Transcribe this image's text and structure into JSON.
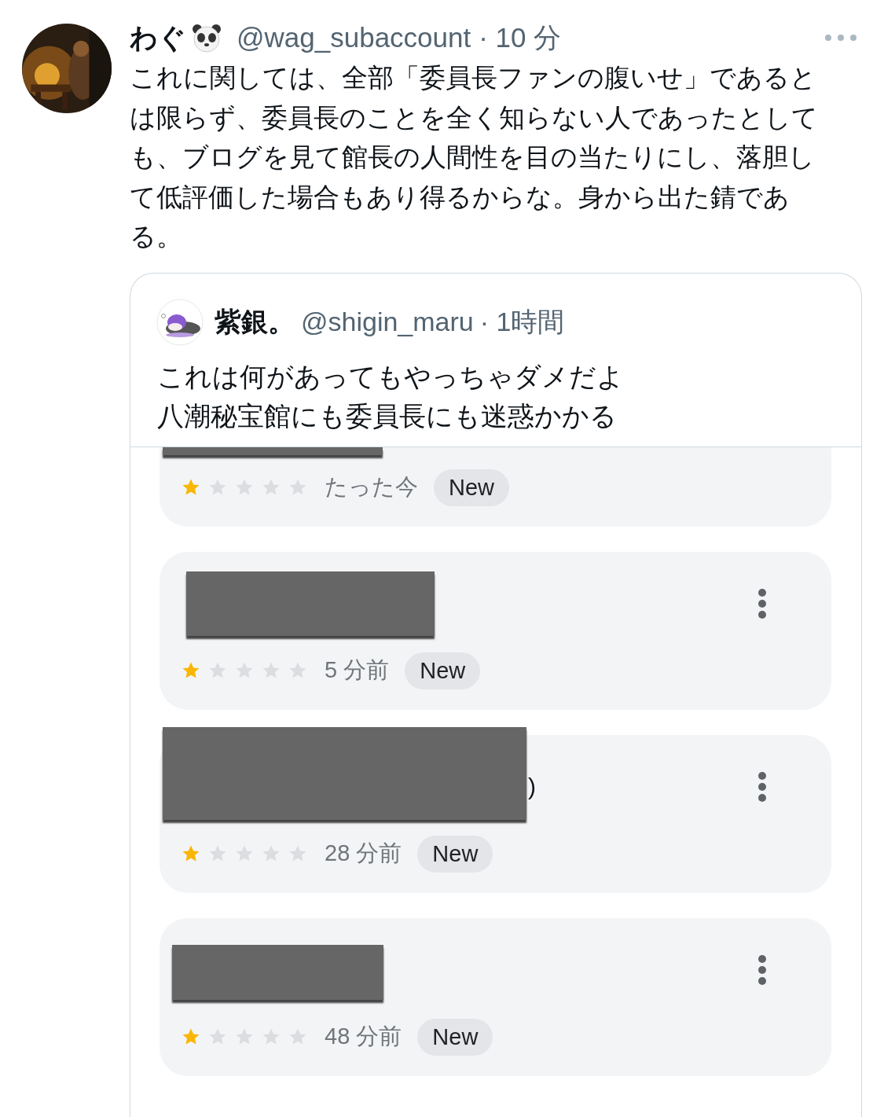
{
  "tweet": {
    "name": "わぐ",
    "handle": "@wag_subaccount",
    "time": "· 10 分",
    "text": "これに関しては、全部「委員長ファンの腹いせ」であるとは限らず、委員長のことを全く知らない人であったとしても、ブログを見て館長の人間性を目の当たりにし、落胆して低評価した場合もあり得るからな。身から出た錆である。"
  },
  "quote": {
    "name": "紫銀。",
    "handle": "@shigin_maru",
    "time": "· 1時間",
    "lines": [
      "これは何があってもやっちゃダメだよ",
      "八潮秘宝館にも委員長にも迷惑かかる"
    ],
    "reviews": [
      {
        "stars": 1,
        "time": "たった今",
        "badge": "New",
        "menu": false,
        "cut": true
      },
      {
        "stars": 1,
        "time": "5 分前",
        "badge": "New",
        "menu": true,
        "cut": false
      },
      {
        "stars": 1,
        "time": "28 分前",
        "badge": "New",
        "menu": true,
        "cut": false,
        "name_tail": ")"
      },
      {
        "stars": 1,
        "time": "48 分前",
        "badge": "New",
        "menu": true,
        "cut": false
      }
    ]
  }
}
